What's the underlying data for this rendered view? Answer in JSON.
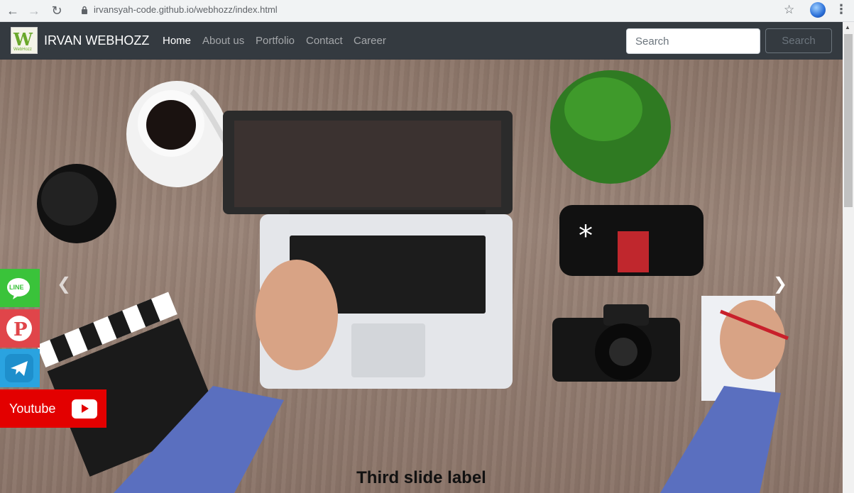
{
  "browser": {
    "url": "irvansyah-code.github.io/webhozz/index.html"
  },
  "navbar": {
    "brand": "IRVAN WEBHOZZ",
    "logo_text": "W",
    "logo_subtext": "WebHozz",
    "items": [
      {
        "label": "Home",
        "active": true
      },
      {
        "label": "About us",
        "active": false
      },
      {
        "label": "Portfolio",
        "active": false
      },
      {
        "label": "Contact",
        "active": false
      },
      {
        "label": "Career",
        "active": false
      }
    ],
    "search_placeholder": "Search",
    "search_button": "Search"
  },
  "carousel": {
    "caption": "Third slide label",
    "prev_icon": "chevron-left-icon",
    "next_icon": "chevron-right-icon"
  },
  "social": {
    "line_label": "LINE",
    "youtube_label": "Youtube",
    "icons": [
      "line-icon",
      "pinterest-icon",
      "telegram-icon",
      "youtube-icon"
    ]
  },
  "colors": {
    "navbar_bg": "#343a40",
    "line_green": "#3ac33a",
    "pinterest_red": "#e0454a",
    "telegram_blue": "#2aa3e0",
    "youtube_red": "#e30000"
  }
}
